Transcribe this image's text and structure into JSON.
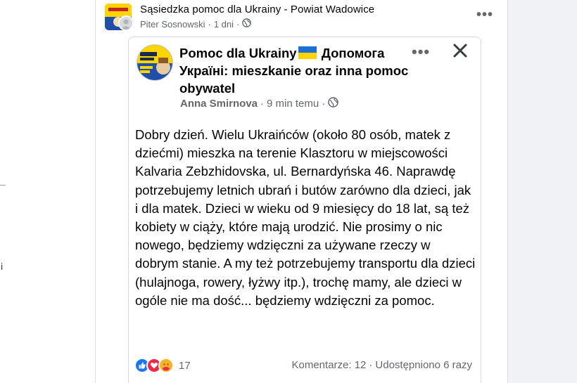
{
  "left_gutter": {
    "stray_char": "i"
  },
  "outer_post": {
    "group_name": "Sąsiedzka pomoc dla Ukrainy - Powiat Wadowice",
    "author": "Piter Sosnowski",
    "separator": "·",
    "time": "1 dni",
    "more_label": "•••"
  },
  "shared_post": {
    "title_part1": "Pomoc dla Ukrainy",
    "title_part2": " Допомога Україні: mieszkanie oraz inna pomoc obywatel",
    "author": "Anna Smirnova",
    "separator": "·",
    "time": "9 min temu",
    "more_label": "•••",
    "body": "Dobry dzień.  Wielu Ukraińców (około 80 osób, matek z dziećmi) mieszka na terenie Klasztoru w miejscowości Kalvaria Zebzhidovska, ul. Bernardyńska 46.  Naprawdę potrzebujemy letnich ubrań i butów zarówno dla dzieci, jak i dla matek. Dzieci w wieku od 9 miesięcy do 18 lat, są też kobiety w ciąży, które mają urodzić.  Nie prosimy o nic nowego, będziemy wdzięczni za używane rzeczy w dobrym stanie.  A my też potrzebujemy transportu dla dzieci (hulajnoga, rowery, łyżwy itp.), trochę mamy, ale dzieci w ogóle nie ma dość... będziemy wdzięczni za pomoc.",
    "reaction_count": "17",
    "comments": "Komentarze: 12",
    "stats_separator": "·",
    "shares": "Udostępniono 6 razy"
  },
  "colors": {
    "flag_blue": "#1f6fd1",
    "flag_yellow": "#ffd400",
    "like_blue": "#1877f2",
    "love_red": "#f02849",
    "care_yellow": "#f7b125",
    "meta_gray": "#65676b"
  },
  "icons": {
    "globe": "globe-icon",
    "close": "close-icon",
    "like": "like-reaction-icon",
    "love": "love-reaction-icon",
    "care": "care-reaction-icon"
  }
}
